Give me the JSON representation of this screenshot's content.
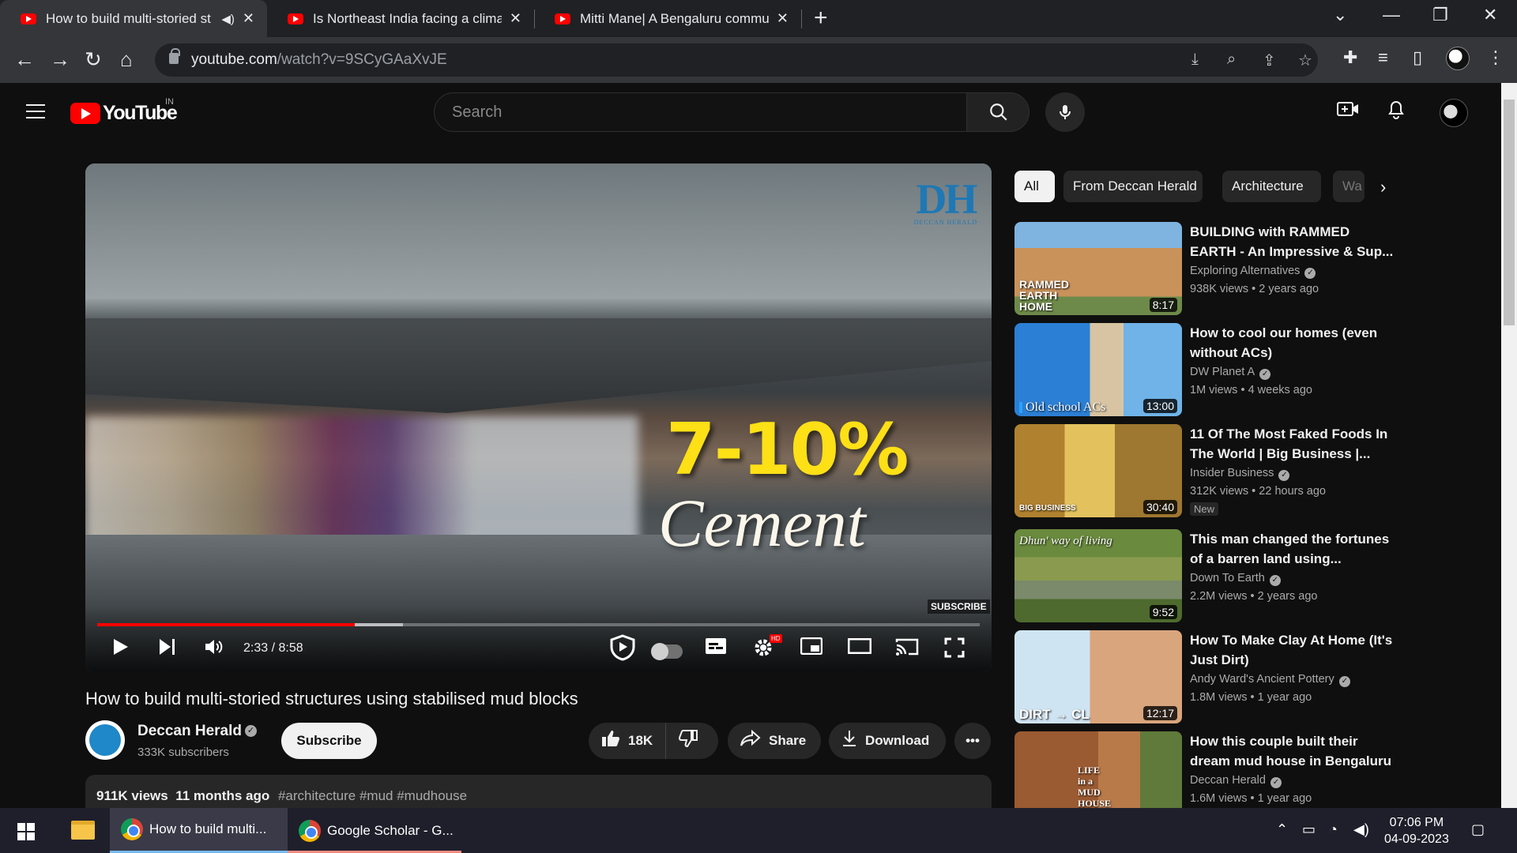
{
  "browser": {
    "tabs": [
      {
        "title": "How to build multi-storied st",
        "active": true,
        "audio": true
      },
      {
        "title": "Is Northeast India facing a climat",
        "active": false
      },
      {
        "title": "Mitti Mane| A Bengaluru commu",
        "active": false
      }
    ],
    "url_domain": "youtube.com",
    "url_path": "/watch?v=9SCyGAaXvJE"
  },
  "youtube": {
    "region": "IN",
    "search_placeholder": "Search"
  },
  "player": {
    "watermark": "DH",
    "watermark_sub": "DECCAN HERALD",
    "overlay_percent": "7-10%",
    "overlay_word": "Cement",
    "subscribe_watermark": "SUBSCRIBE",
    "time": "2:33 / 8:58",
    "progress": 0.292,
    "hd_badge": "HD"
  },
  "video": {
    "title": "How to build multi-storied structures using stabilised mud blocks",
    "channel": "Deccan Herald",
    "subscribers": "333K subscribers",
    "subscribe_label": "Subscribe",
    "likes": "18K",
    "share_label": "Share",
    "download_label": "Download",
    "views": "911K views",
    "age": "11 months ago",
    "tags": "#architecture #mud #mudhouse"
  },
  "chips": [
    "All",
    "From Deccan Herald",
    "Architecture",
    "Wa"
  ],
  "recommendations": [
    {
      "title": "BUILDING with RAMMED EARTH - An Impressive & Sup...",
      "channel": "Exploring Alternatives",
      "views": "938K views",
      "age": "2 years ago",
      "duration": "8:17",
      "thumb_text": "RAMMED EARTH HOME",
      "badge": ""
    },
    {
      "title": "How to cool our homes (even without ACs)",
      "channel": "DW Planet A",
      "views": "1M views",
      "age": "4 weeks ago",
      "duration": "13:00",
      "thumb_text": "Old school ACs",
      "badge": ""
    },
    {
      "title": "11 Of The Most Faked Foods In The World | Big Business |...",
      "channel": "Insider Business",
      "views": "312K views",
      "age": "22 hours ago",
      "duration": "30:40",
      "thumb_text": "BIG BUSINESS",
      "badge": "New"
    },
    {
      "title": "This man changed the fortunes of a barren land using...",
      "channel": "Down To Earth",
      "views": "2.2M views",
      "age": "2 years ago",
      "duration": "9:52",
      "thumb_text": "Dhun' way of living",
      "badge": ""
    },
    {
      "title": "How To Make Clay At Home (It's Just Dirt)",
      "channel": "Andy Ward's Ancient Pottery",
      "views": "1.8M views",
      "age": "1 year ago",
      "duration": "12:17",
      "thumb_text": "DIRT → CL",
      "badge": ""
    },
    {
      "title": "How this couple built their dream mud house in Bengaluru",
      "channel": "Deccan Herald",
      "views": "1.6M views",
      "age": "1 year ago",
      "duration": "",
      "thumb_text": "LIFE in a MUD HOUSE",
      "badge": ""
    }
  ],
  "taskbar": {
    "items": [
      "How to build multi...",
      "Google Scholar - G..."
    ],
    "time": "07:06 PM",
    "date": "04-09-2023"
  }
}
